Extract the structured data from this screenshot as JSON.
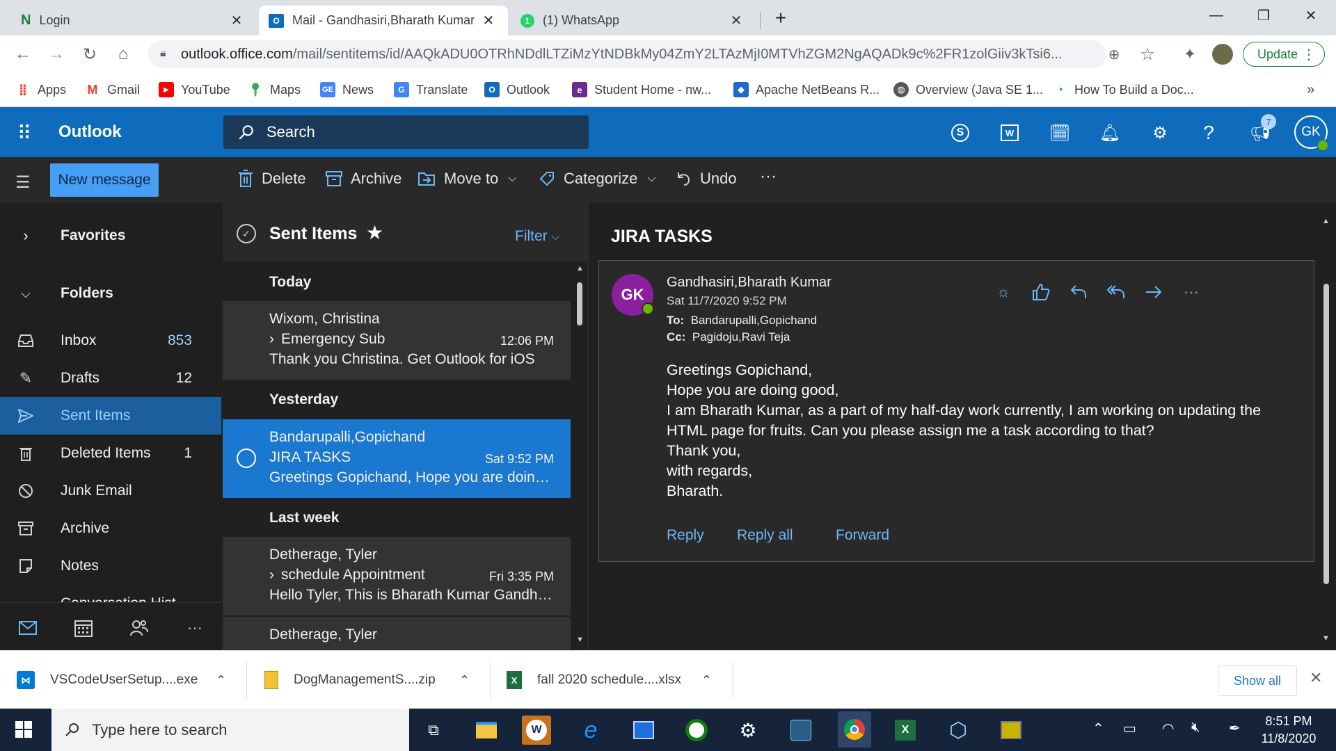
{
  "browser": {
    "tabs": [
      {
        "title": "Login",
        "icon": "n-icon"
      },
      {
        "title": "Mail - Gandhasiri,Bharath Kumar",
        "icon": "outlook-icon"
      },
      {
        "title": "(1) WhatsApp",
        "icon": "whatsapp-icon"
      }
    ],
    "url_domain": "outlook.office.com",
    "url_path": "/mail/sentitems/id/AAQkADU0OTRhNDdlLTZiMzYtNDBkMy04ZmY2LTAzMjI0MTVhZGM2NgAQADk9c%2FR1zolGiiv3kTsi6...",
    "update_label": "Update",
    "bookmarks": [
      "Apps",
      "Gmail",
      "YouTube",
      "Maps",
      "News",
      "Translate",
      "Outlook",
      "Student Home - nw...",
      "Apache NetBeans R...",
      "Overview (Java SE 1...",
      "How To Build a Doc..."
    ],
    "notification_count": "7"
  },
  "outlook": {
    "app_name": "Outlook",
    "search_placeholder": "Search",
    "avatar_initials": "GK",
    "new_message": "New message",
    "commands": {
      "delete": "Delete",
      "archive": "Archive",
      "move_to": "Move to",
      "categorize": "Categorize",
      "undo": "Undo",
      "more": "···"
    },
    "nav": {
      "favorites": "Favorites",
      "folders": "Folders",
      "items": [
        {
          "label": "Inbox",
          "count": "853"
        },
        {
          "label": "Drafts",
          "count": "12"
        },
        {
          "label": "Sent Items",
          "count": ""
        },
        {
          "label": "Deleted Items",
          "count": "1"
        },
        {
          "label": "Junk Email",
          "count": ""
        },
        {
          "label": "Archive",
          "count": ""
        },
        {
          "label": "Notes",
          "count": ""
        },
        {
          "label": "Conversation Hist...",
          "count": ""
        }
      ]
    },
    "list": {
      "title": "Sent Items",
      "filter": "Filter",
      "groups": [
        "Today",
        "Yesterday",
        "Last week"
      ],
      "messages": [
        {
          "sender": "Wixom, Christina",
          "subject": "Emergency Sub",
          "time": "12:06 PM",
          "preview": "Thank you Christina. Get Outlook for iOS"
        },
        {
          "sender": "Bandarupalli,Gopichand",
          "subject": "JIRA TASKS",
          "time": "Sat 9:52 PM",
          "preview": "Greetings Gopichand, Hope you are doing..."
        },
        {
          "sender": "Detherage, Tyler",
          "subject": "schedule Appointment",
          "time": "Fri 3:35 PM",
          "preview": "Hello Tyler, This is Bharath Kumar Gandha..."
        },
        {
          "sender": "Detherage, Tyler",
          "subject": "",
          "time": "",
          "preview": ""
        }
      ]
    },
    "reading": {
      "subject": "JIRA TASKS",
      "avatar": "GK",
      "from": "Gandhasiri,Bharath Kumar",
      "date": "Sat 11/7/2020 9:52 PM",
      "to_label": "To:",
      "to": "Bandarupalli,Gopichand",
      "cc_label": "Cc:",
      "cc": "Pagidoju,Ravi Teja",
      "body": [
        "Greetings Gopichand,",
        "Hope you are doing good,",
        "I am Bharath Kumar, as a part of my half-day work currently, I am working on updating the",
        "HTML page for fruits. Can you please assign me a task according to that?",
        "Thank you,",
        "with regards,",
        "Bharath."
      ],
      "reply": "Reply",
      "reply_all": "Reply all",
      "forward": "Forward"
    }
  },
  "downloads": {
    "files": [
      "VSCodeUserSetup....exe",
      "DogManagementS....zip",
      "fall 2020 schedule....xlsx"
    ],
    "show_all": "Show all"
  },
  "taskbar": {
    "search_placeholder": "Type here to search",
    "time": "8:51 PM",
    "date": "11/8/2020"
  },
  "colors": {
    "outlook_blue": "#0f6cbd",
    "selected_item": "#1b78d0",
    "link_blue": "#6cb8f6",
    "chrome_update_green": "#188038"
  }
}
